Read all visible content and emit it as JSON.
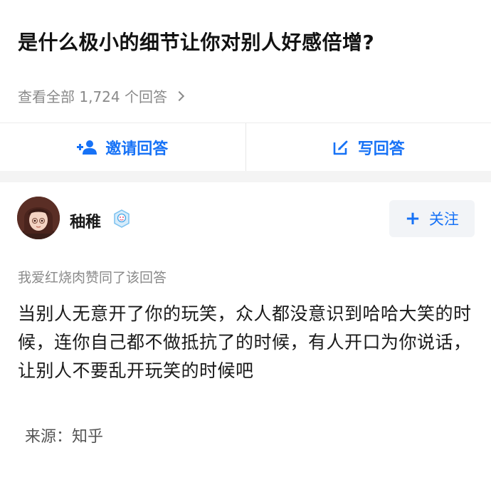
{
  "question": {
    "title": "是什么极小的细节让你对别人好感倍增?",
    "view_all_label": "查看全部 1,724 个回答"
  },
  "actions": {
    "invite_label": "邀请回答",
    "write_label": "写回答",
    "invite_icon": "add-user-icon",
    "write_icon": "edit-icon"
  },
  "answer": {
    "author_name": "秞稚",
    "badge_icon": "verified-badge-icon",
    "follow_label": "关注",
    "upvote_note": "我爱红烧肉赞同了该回答",
    "content": "当别人无意开了你的玩笑，众人都没意识到哈哈大笑的时候，连你自己都不做抵抗了的时候，有人开口为你说话，让别人不要乱开玩笑的时候吧",
    "source": "来源：知乎"
  },
  "colors": {
    "accent": "#1772f6",
    "muted_text": "#8a8a8a",
    "band": "#f4f4f4"
  }
}
